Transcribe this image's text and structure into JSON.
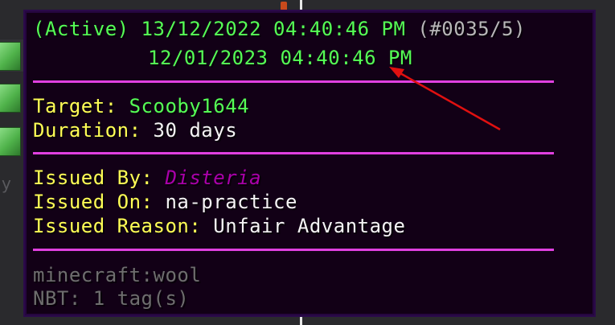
{
  "tooltip": {
    "header": {
      "status": "(Active)",
      "start": "13/12/2022 04:40:46 PM",
      "id": "(#0035/5)"
    },
    "expiry": "12/01/2023 04:40:46 PM",
    "target": {
      "label": "Target:",
      "value": "Scooby1644"
    },
    "duration": {
      "label": "Duration:",
      "value": "30 days"
    },
    "issued_by": {
      "label": "Issued By:",
      "value": "Disteria"
    },
    "issued_on": {
      "label": "Issued On:",
      "value": "na-practice"
    },
    "issued_reason": {
      "label": "Issued Reason:",
      "value": "Unfair Advantage"
    },
    "item_id": "minecraft:wool",
    "nbt": "NBT: 1 tag(s)"
  },
  "background": {
    "side_letter": "y"
  },
  "colors": {
    "tooltip_bg": "#120016",
    "separator": "#e040e0",
    "green": "#55ff55",
    "yellow": "#ffff55",
    "purple": "#aa00aa",
    "arrow": "#e01010"
  }
}
